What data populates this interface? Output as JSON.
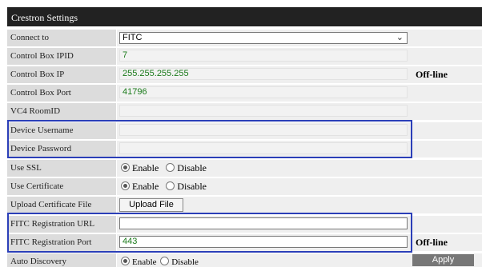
{
  "header": {
    "title": "Crestron Settings"
  },
  "rows": {
    "connect_to": {
      "label": "Connect to",
      "value": "FITC"
    },
    "control_box_ipid": {
      "label": "Control Box IPID",
      "value": "7"
    },
    "control_box_ip": {
      "label": "Control Box IP",
      "value": "255.255.255.255",
      "status": "Off-line"
    },
    "control_box_port": {
      "label": "Control Box Port",
      "value": "41796"
    },
    "vc4_roomid": {
      "label": "VC4 RoomID",
      "value": ""
    },
    "device_username": {
      "label": "Device Username",
      "value": ""
    },
    "device_password": {
      "label": "Device Password",
      "value": ""
    },
    "use_ssl": {
      "label": "Use SSL",
      "enable": "Enable",
      "disable": "Disable",
      "selected": "Enable"
    },
    "use_certificate": {
      "label": "Use Certificate",
      "enable": "Enable",
      "disable": "Disable",
      "selected": "Enable"
    },
    "upload_certificate": {
      "label": "Upload Certificate File",
      "button": "Upload File"
    },
    "fitc_registration_url": {
      "label": "FITC Registration URL",
      "value": ""
    },
    "fitc_registration_port": {
      "label": "FITC Registration Port",
      "value": "443",
      "status": "Off-line"
    },
    "auto_discovery": {
      "label": "Auto Discovery",
      "enable": "Enable",
      "disable": "Disable",
      "selected": "Enable",
      "apply": "Apply"
    }
  },
  "colors": {
    "header_bg": "#222222",
    "label_bg": "#dcdcdc",
    "highlight": "#2b3fb8",
    "value_text": "#1a7a1a"
  }
}
